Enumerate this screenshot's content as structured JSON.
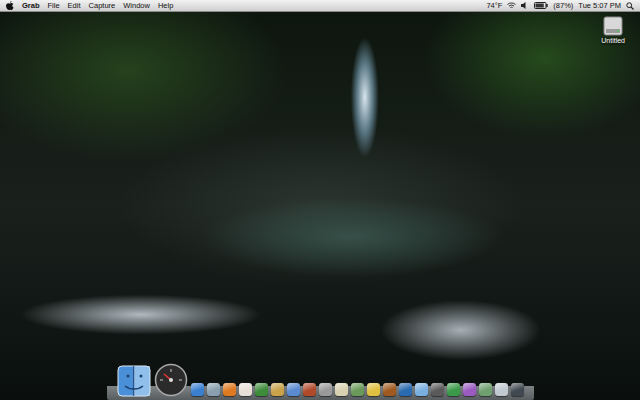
{
  "menubar": {
    "app": "Grab",
    "menus": [
      "File",
      "Edit",
      "Capture",
      "Window",
      "Help"
    ],
    "weather": "74°F",
    "battery": {
      "level": 0.87,
      "reading": "(87%)"
    },
    "clock": "Tue 5:07 PM"
  },
  "desktop": {
    "icons": [
      {
        "label": "Untitled",
        "selected": false
      }
    ]
  },
  "dock": {
    "items": [
      {
        "kind": "finder",
        "color": "#4a90d9"
      },
      {
        "kind": "dashboard",
        "color": "#2b2b2b"
      },
      {
        "kind": "app",
        "color": "#3a7fd0"
      },
      {
        "kind": "app",
        "color": "#8aa0b0"
      },
      {
        "kind": "app",
        "color": "#e07a20"
      },
      {
        "kind": "app",
        "color": "#e8e0d8"
      },
      {
        "kind": "app",
        "color": "#3c8c3a"
      },
      {
        "kind": "app",
        "color": "#c9a24a"
      },
      {
        "kind": "app",
        "color": "#5a8ad0"
      },
      {
        "kind": "app",
        "color": "#b04a2a"
      },
      {
        "kind": "app",
        "color": "#9a9a9a"
      },
      {
        "kind": "app",
        "color": "#d8d0b0"
      },
      {
        "kind": "app",
        "color": "#6a9a5a"
      },
      {
        "kind": "app",
        "color": "#e0c040"
      },
      {
        "kind": "app",
        "color": "#a05a20"
      },
      {
        "kind": "app",
        "color": "#2a6ab0"
      },
      {
        "kind": "app",
        "color": "#7ab0e0"
      },
      {
        "kind": "app",
        "color": "#5a5a5a"
      },
      {
        "kind": "app",
        "color": "#3a9a4a"
      },
      {
        "kind": "app",
        "color": "#9a5ac0"
      },
      {
        "kind": "app",
        "color": "#70a070"
      },
      {
        "kind": "app",
        "color": "#c0c8d0"
      },
      {
        "kind": "app",
        "color": "#404850"
      }
    ]
  }
}
